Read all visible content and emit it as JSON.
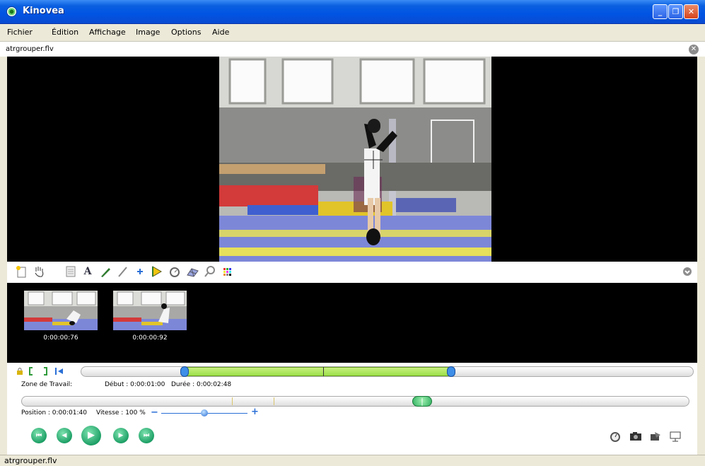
{
  "window": {
    "title": "Kinovea",
    "buttons": {
      "minimize": "_",
      "maximize": "❐",
      "close": "✕"
    }
  },
  "menu": [
    "Fichier",
    "Édition",
    "Affichage",
    "Image",
    "Options",
    "Aide"
  ],
  "file_tab": {
    "name": "atrgrouper.flv",
    "close_glyph": "✕"
  },
  "keyframes": [
    {
      "time": "0:00:00:76"
    },
    {
      "time": "0:00:00:92"
    }
  ],
  "working_zone": {
    "label": "Zone de Travail:",
    "start": "Début : 0:00:01:00",
    "duration": "Durée : 0:00:02:48",
    "selection_start_fraction": 0.16,
    "selection_end_fraction": 0.6
  },
  "playback": {
    "position": "Position : 0:00:01:40",
    "speed": "Vitesse : 100 %",
    "speed_fraction": 0.5,
    "cursor_fraction": 0.6
  },
  "status": {
    "text": "atrgrouper.flv"
  },
  "colors": {
    "titlebar": "#0054e3",
    "accent_green": "#9de04a",
    "button_green": "#1ea066",
    "sidebar_blue": "#2a6fd6"
  },
  "drawing_tools": [
    "add-keyframe-icon",
    "hand-icon",
    "comment-icon",
    "text-icon",
    "pencil-icon",
    "line-icon",
    "cross-icon",
    "angle-icon",
    "chrono-icon",
    "grid-icon",
    "magnifier-icon",
    "color-icon"
  ],
  "glyphs": {
    "text_tool": "A",
    "zoom_minus": "−",
    "zoom_plus": "+"
  }
}
